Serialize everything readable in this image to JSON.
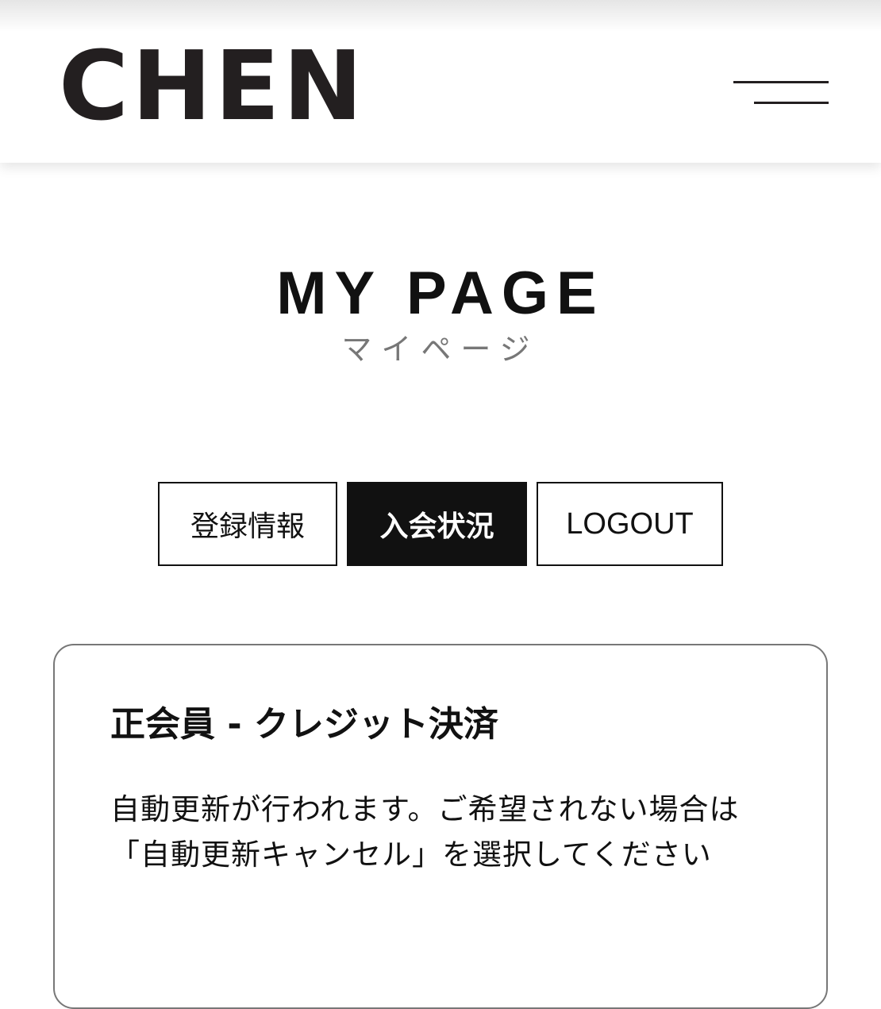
{
  "header": {
    "logo_text": "CHEN",
    "menu_icon": "hamburger-menu-icon"
  },
  "page": {
    "title": "MY PAGE",
    "subtitle": "マイページ"
  },
  "tabs": [
    {
      "label": "登録情報",
      "active": false
    },
    {
      "label": "入会状況",
      "active": true
    },
    {
      "label": "LOGOUT",
      "active": false
    }
  ],
  "membership_card": {
    "title": "正会員 - クレジット決済",
    "description": "自動更新が行われます。ご希望されない場合は「自動更新キャンセル」を選択してください"
  },
  "colors": {
    "text": "#111111",
    "logo": "#231f20",
    "subtitle": "#777777",
    "active_tab_bg": "#111111",
    "card_border": "#777777"
  }
}
